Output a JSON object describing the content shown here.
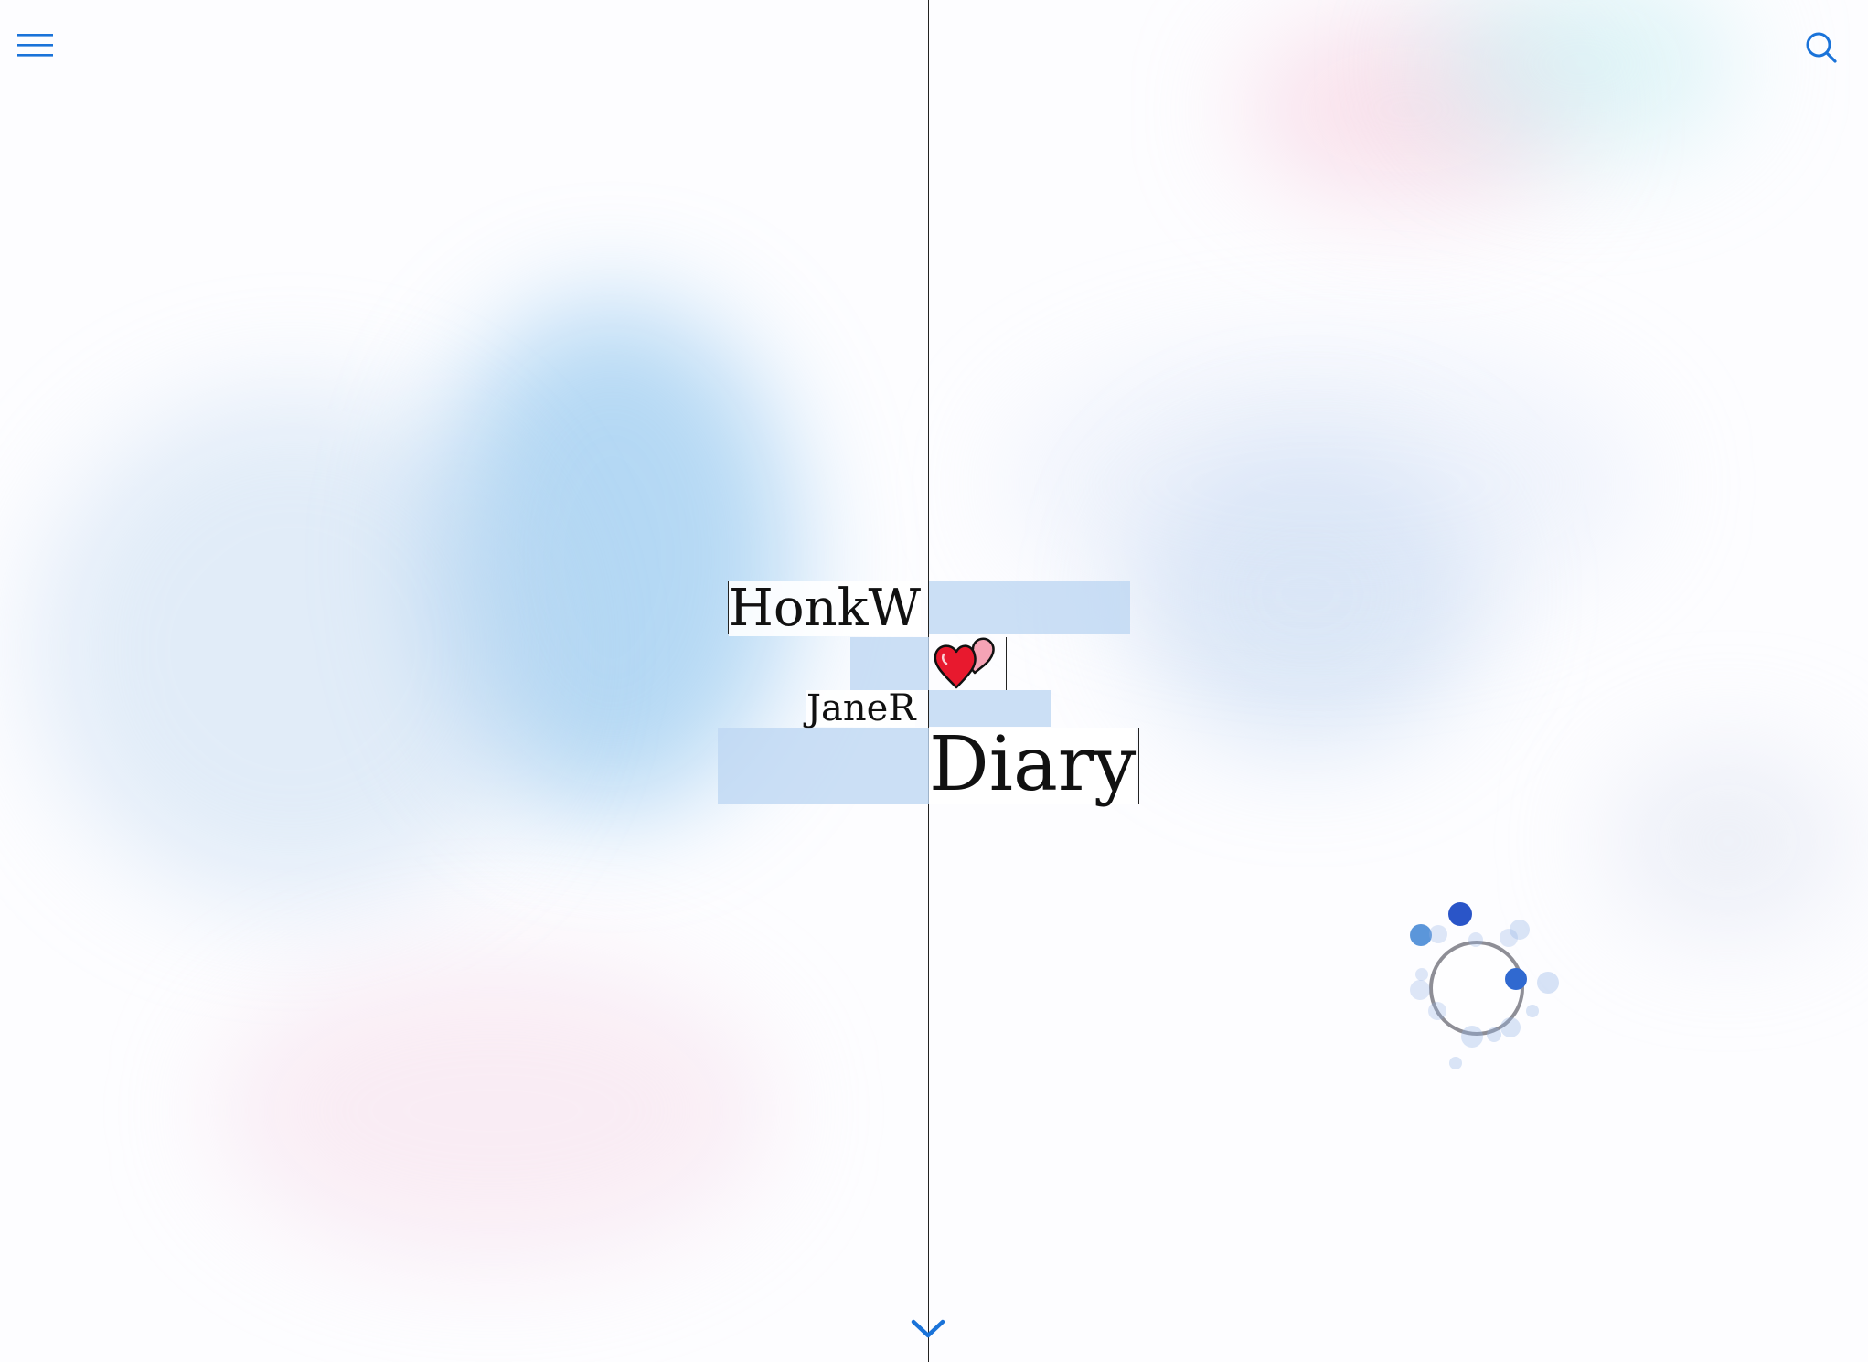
{
  "header": {
    "menu_icon": "hamburger-menu-icon",
    "search_icon": "search-icon"
  },
  "hero": {
    "name_primary": "HonkW",
    "heart_icon": "two-hearts-icon",
    "name_secondary": "JaneR",
    "title": "Diary"
  },
  "footer": {
    "scroll_icon": "chevron-down-icon"
  },
  "colors": {
    "accent": "#1a73d9",
    "text": "#111111",
    "highlight": "#bed7f3",
    "heart_red": "#e8192e",
    "heart_pink": "#f5a3b5"
  },
  "loading": {
    "spinner_icon": "loading-spinner-icon"
  }
}
